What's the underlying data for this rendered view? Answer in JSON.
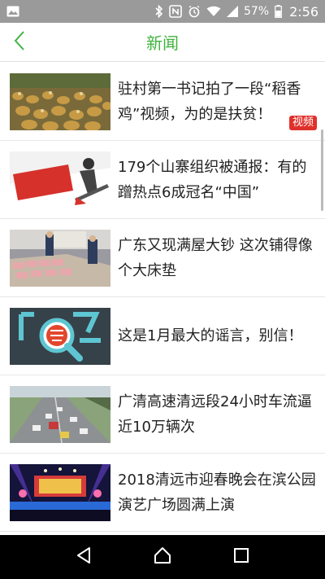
{
  "status_bar": {
    "icons": [
      "image-icon",
      "bluetooth-icon",
      "nfc-icon",
      "alarm-icon",
      "wifi-icon",
      "signal-icon",
      "battery-icon"
    ],
    "battery_percent": "57%",
    "time": "2:56"
  },
  "header": {
    "title": "新闻",
    "back_icon": "chevron-left-icon",
    "accent_color": "#3fb33f"
  },
  "news": [
    {
      "title": "驻村第一书记拍了一段“稻香鸡”视频，为的是扶贫！",
      "badge": "视频",
      "thumbnail": "flock of chickens"
    },
    {
      "title": "179个山寨组织被通报：有的蹭热点6成冠名“中国”",
      "thumbnail": "山寨社团 illustration"
    },
    {
      "title": "广东又现满屋大钞 这次铺得像个大床垫",
      "thumbnail": "banknotes on table"
    },
    {
      "title": "这是1月最大的谣言，别信！",
      "thumbnail": "谣 magnifier graphic"
    },
    {
      "title": "广清高速清远段24小时车流逼近10万辆次",
      "thumbnail": "highway traffic"
    },
    {
      "title": "2018清远市迎春晚会在滨公园演艺广场圆满上演",
      "thumbnail": "stage performance"
    }
  ],
  "nav_bar": {
    "back_icon": "back-triangle-icon",
    "home_icon": "home-icon",
    "recents_icon": "recents-square-icon"
  }
}
